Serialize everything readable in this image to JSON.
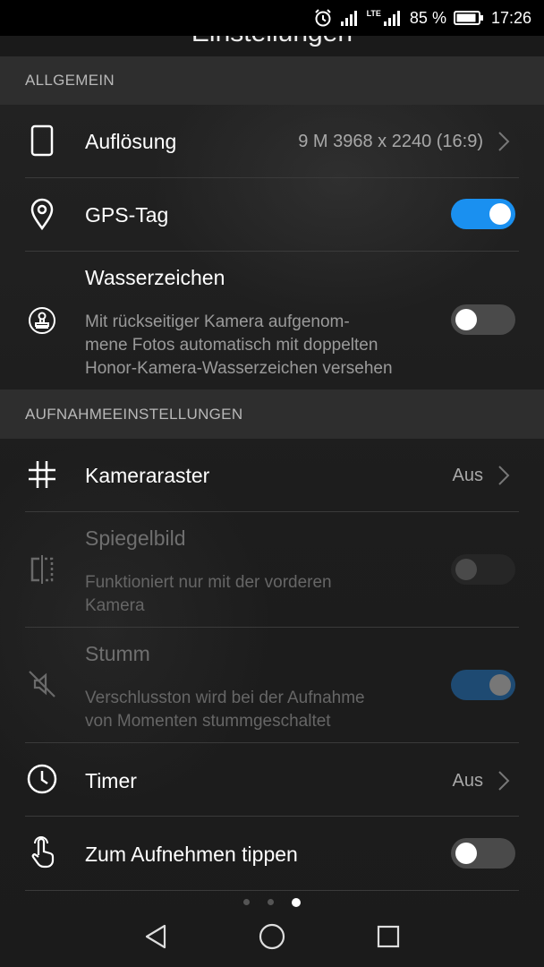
{
  "status_bar": {
    "battery_percent": "85 %",
    "time": "17:26",
    "network": "LTE"
  },
  "header": {
    "title": "Einstellungen"
  },
  "sections": {
    "general": "ALLGEMEIN",
    "capture": "AUFNAHMEEINSTELLUNGEN"
  },
  "settings": {
    "resolution": {
      "label": "Auflösung",
      "value": "9 M 3968 x 2240 (16:9)"
    },
    "gps_tag": {
      "label": "GPS-Tag",
      "enabled": true
    },
    "watermark": {
      "label": "Wasserzeichen",
      "description_1": "Mit rückseitiger Kamera aufgenom-",
      "description_2": "mene Fotos automatisch mit doppelten",
      "description_3": "Honor-Kamera-Wasserzeichen versehen",
      "enabled": false
    },
    "grid": {
      "label": "Kameraraster",
      "value": "Aus"
    },
    "mirror": {
      "label": "Spiegelbild",
      "description_1": "Funktioniert nur mit der vorderen",
      "description_2": "Kamera",
      "disabled": true,
      "enabled": false
    },
    "mute": {
      "label": "Stumm",
      "description_1": "Verschlusston wird bei der Aufnahme",
      "description_2": "von Momenten stummgeschaltet",
      "disabled": true,
      "enabled": true
    },
    "timer": {
      "label": "Timer",
      "value": "Aus"
    },
    "tap_to_capture": {
      "label": "Zum Aufnehmen tippen",
      "enabled": false
    }
  },
  "pager": {
    "pages": 3,
    "active_page": 3
  },
  "colors": {
    "accent": "#1a90f0",
    "accent_disabled": "#1e4a72",
    "switch_off": "#4a4a4a",
    "section_bg": "#2e2e2e"
  },
  "icons": {
    "resolution": "phone-outline-icon",
    "gps": "location-pin-icon",
    "watermark": "stamp-icon",
    "grid": "grid-icon",
    "mirror": "mirror-icon",
    "mute": "mute-icon",
    "timer": "clock-icon",
    "tap": "tap-hand-icon"
  }
}
